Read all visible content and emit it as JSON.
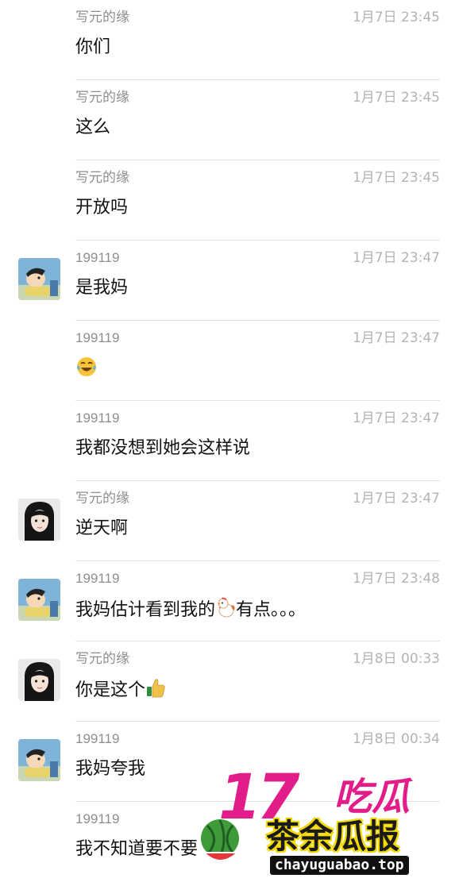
{
  "messages": [
    {
      "sender": "写元的缘",
      "time": "1月7日 23:45",
      "text": "你们",
      "avatar": null
    },
    {
      "sender": "写元的缘",
      "time": "1月7日 23:45",
      "text": "这么",
      "avatar": null
    },
    {
      "sender": "写元的缘",
      "time": "1月7日 23:45",
      "text": "开放吗",
      "avatar": null
    },
    {
      "sender": "199119",
      "time": "1月7日 23:47",
      "text": "是我妈",
      "avatar": "cartoon-avatar"
    },
    {
      "sender": "199119",
      "time": "1月7日 23:47",
      "text": "",
      "emoji": "laughing-tears-emoji",
      "avatar": null
    },
    {
      "sender": "199119",
      "time": "1月7日 23:47",
      "text": "我都没想到她会这样说",
      "avatar": null
    },
    {
      "sender": "写元的缘",
      "time": "1月7日 23:47",
      "text": "逆天啊",
      "avatar": "girl-avatar"
    },
    {
      "sender": "199119",
      "time": "1月7日 23:48",
      "text": "我妈估计看到我的",
      "emoji": "chicken-emoji",
      "text_after": "有点。。。",
      "avatar": "cartoon-avatar"
    },
    {
      "sender": "写元的缘",
      "time": "1月8日 00:33",
      "text": "你是这个",
      "emoji": "thumbs-up-emoji",
      "avatar": "girl-avatar"
    },
    {
      "sender": "199119",
      "time": "1月8日 00:34",
      "text": "我妈夸我",
      "avatar": "cartoon-avatar"
    },
    {
      "sender": "199119",
      "time": "",
      "text": "我不知道要不要",
      "avatar": null
    }
  ],
  "watermark": {
    "brand_number": "17",
    "brand_word": "吃瓜",
    "brand_cn": "茶余瓜报",
    "url": "chayuguabao.top"
  },
  "colors": {
    "name": "#8e8e8e",
    "time": "#b3b3b3",
    "text": "#111111",
    "divider": "#e4e4e4",
    "brand": "#e21d8a"
  }
}
